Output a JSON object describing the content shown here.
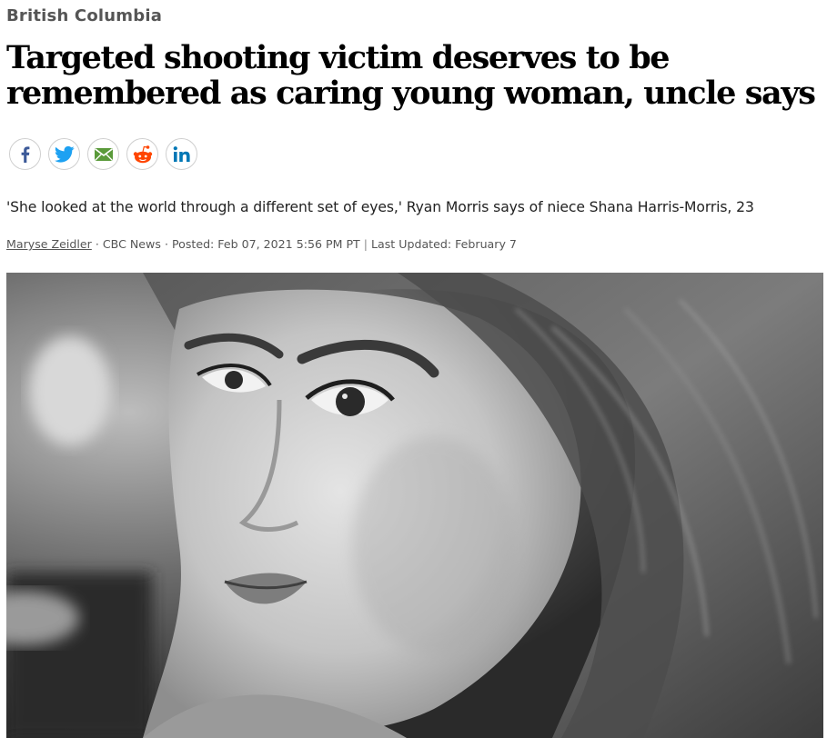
{
  "article": {
    "section": "British Columbia",
    "headline": "Targeted shooting victim deserves to be remembered as caring young woman, uncle says",
    "deck": "'She looked at the world through a different set of eyes,' Ryan Morris says of niece Shana Harris-Morris, 23",
    "byline": {
      "author": "Maryse Zeidler",
      "separator1": "·",
      "source": "CBC News",
      "separator2": "·",
      "posted": "Posted: Feb 07, 2021 5:56 PM PT",
      "pipe": "|",
      "updated": "Last Updated: February 7"
    }
  },
  "share": {
    "buttons": [
      {
        "name": "facebook",
        "icon": "facebook-icon",
        "color": "#3b5998"
      },
      {
        "name": "twitter",
        "icon": "twitter-icon",
        "color": "#1da1f2"
      },
      {
        "name": "email",
        "icon": "email-icon",
        "color": "#5a9a3a"
      },
      {
        "name": "reddit",
        "icon": "reddit-icon",
        "color": "#ff4500"
      },
      {
        "name": "linkedin",
        "icon": "linkedin-icon",
        "color": "#0077b5"
      }
    ]
  },
  "photo": {
    "description_icon": "portrait-photo",
    "tone": "black-and-white"
  }
}
